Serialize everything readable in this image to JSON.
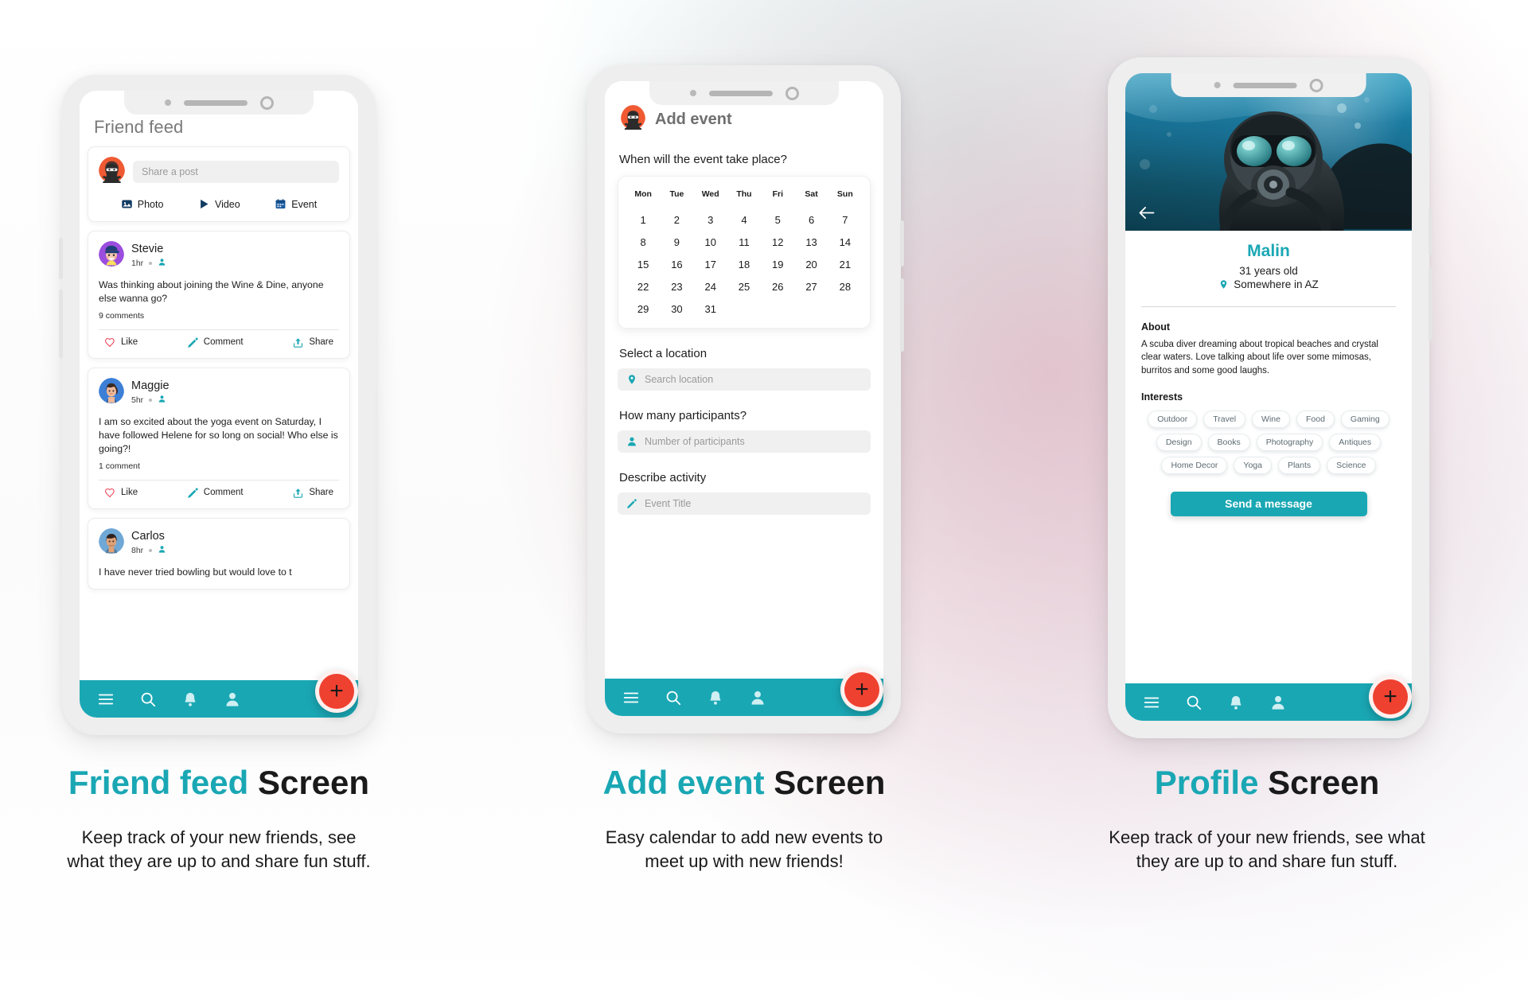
{
  "colors": {
    "accent": "#1aa7b4",
    "fab": "#ef4130",
    "like": "#ef4b5e",
    "tag_text": "#5c6b72"
  },
  "screens": [
    {
      "id": "friend-feed",
      "header": "Friend feed",
      "composer": {
        "placeholder": "Share a post",
        "actions": [
          {
            "icon": "photo-icon",
            "label": "Photo"
          },
          {
            "icon": "video-icon",
            "label": "Video"
          },
          {
            "icon": "calendar-icon",
            "label": "Event"
          }
        ]
      },
      "posts": [
        {
          "name": "Stevie",
          "time": "1hr",
          "text": "Was thinking about joining the Wine & Dine, anyone else wanna go?",
          "comments": "9 comments",
          "actions": [
            "Like",
            "Comment",
            "Share"
          ]
        },
        {
          "name": "Maggie",
          "time": "5hr",
          "text": "I am so excited about the yoga event on Saturday, I have followed Helene for so long on social! Who else is going?!",
          "comments": "1 comment",
          "actions": [
            "Like",
            "Comment",
            "Share"
          ]
        },
        {
          "name": "Carlos",
          "time": "8hr",
          "text": "I have never tried bowling but would love to t",
          "comments": "",
          "actions": []
        }
      ],
      "fab": "+",
      "nav": [
        "menu-icon",
        "search-icon",
        "bell-icon",
        "person-icon"
      ],
      "caption": {
        "highlight": "Friend feed",
        "rest": "Screen",
        "desc": "Keep track of your new friends, see what they are up to and share fun stuff."
      }
    },
    {
      "id": "add-event",
      "header": "Add event",
      "question": "When will the event take place?",
      "calendar": {
        "dow": [
          "Mon",
          "Tue",
          "Wed",
          "Thu",
          "Fri",
          "Sat",
          "Sun"
        ],
        "days": [
          1,
          2,
          3,
          4,
          5,
          6,
          7,
          8,
          9,
          10,
          11,
          12,
          13,
          14,
          15,
          16,
          17,
          18,
          19,
          20,
          21,
          22,
          23,
          24,
          25,
          26,
          27,
          28,
          29,
          30,
          31
        ]
      },
      "fields": [
        {
          "label": "Select a location",
          "icon": "pin-icon",
          "placeholder": "Search location"
        },
        {
          "label": "How many participants?",
          "icon": "person-icon",
          "placeholder": "Number of participants"
        },
        {
          "label": "Describe activity",
          "icon": "pencil-icon",
          "placeholder": "Event Title"
        }
      ],
      "fab": "+",
      "nav": [
        "menu-icon",
        "search-icon",
        "bell-icon",
        "person-icon"
      ],
      "caption": {
        "highlight": "Add event",
        "rest": "Screen",
        "desc": "Easy calendar to add new events to meet up with new friends!"
      }
    },
    {
      "id": "profile",
      "back": "back-arrow-icon",
      "name": "Malin",
      "age": "31 years old",
      "location": "Somewhere in AZ",
      "about_heading": "About",
      "about_text": "A scuba diver dreaming about tropical beaches and crystal clear waters. Love talking about life over some mimosas, burritos and some good laughs.",
      "interests_heading": "Interests",
      "interests": [
        "Outdoor",
        "Travel",
        "Wine",
        "Food",
        "Gaming",
        "Design",
        "Books",
        "Photography",
        "Antiques",
        "Home Decor",
        "Yoga",
        "Plants",
        "Science"
      ],
      "message_button": "Send a message",
      "fab": "+",
      "nav": [
        "menu-icon",
        "search-icon",
        "bell-icon",
        "person-icon"
      ],
      "caption": {
        "highlight": "Profile",
        "rest": "Screen",
        "desc": "Keep track of your new friends, see what they are up to and share fun stuff."
      }
    }
  ]
}
